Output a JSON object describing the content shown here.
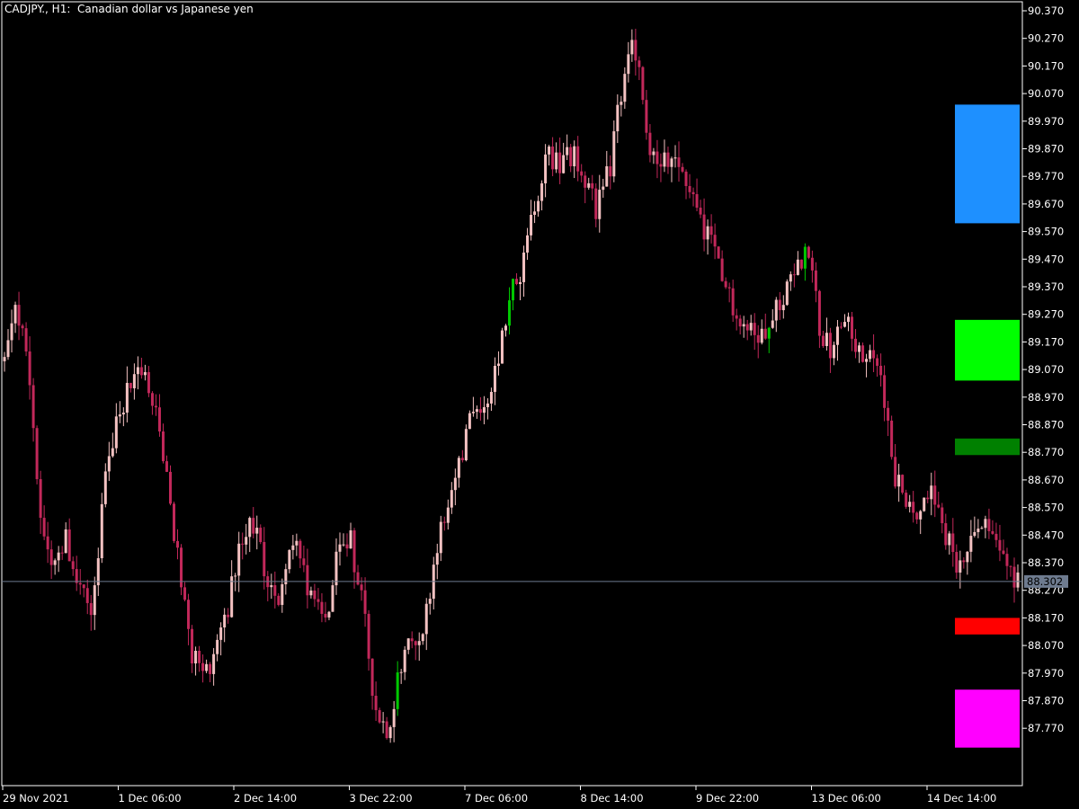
{
  "header": {
    "symbol": "CADJPY., H1:",
    "description": "Canadian dollar vs Japanese yen"
  },
  "colors": {
    "background": "#000000",
    "frame": "#ffffff",
    "bear": "#c2285a",
    "bull": "#f4c2c2",
    "bull_alt": "#00c800",
    "price_line": "#6e7b8f",
    "price_label_bg": "#6e7b8f",
    "tick_text": "#ffffff"
  },
  "chart_data": {
    "type": "candlestick",
    "ylim": [
      87.7,
      90.4
    ],
    "price_ticks": [
      "90.370",
      "90.270",
      "90.170",
      "90.070",
      "89.970",
      "89.870",
      "89.770",
      "89.670",
      "89.570",
      "89.470",
      "89.370",
      "89.270",
      "89.170",
      "89.070",
      "88.970",
      "88.870",
      "88.770",
      "88.670",
      "88.570",
      "88.470",
      "88.370",
      "88.270",
      "88.170",
      "88.070",
      "87.970",
      "87.870",
      "87.770"
    ],
    "time_ticks": [
      "29 Nov 2021",
      "1 Dec 06:00",
      "2 Dec 14:00",
      "3 Dec 22:00",
      "7 Dec 06:00",
      "8 Dec 14:00",
      "9 Dec 22:00",
      "13 Dec 06:00",
      "14 Dec 14:00"
    ],
    "current_price": 88.302,
    "current_price_label": "88.302",
    "bars_per_time_tick": 32,
    "close_path": [
      89.1,
      89.3,
      89.05,
      88.5,
      88.35,
      88.45,
      88.3,
      88.2,
      88.6,
      88.9,
      89.0,
      89.1,
      88.95,
      88.7,
      88.4,
      88.05,
      87.95,
      88.05,
      88.2,
      88.4,
      88.55,
      88.35,
      88.2,
      88.45,
      88.4,
      88.2,
      88.15,
      88.4,
      88.45,
      88.2,
      87.85,
      87.75,
      88.0,
      88.1,
      88.15,
      88.45,
      88.55,
      88.75,
      88.95,
      88.9,
      89.1,
      89.35,
      89.45,
      89.7,
      89.85,
      89.8,
      89.85,
      89.75,
      89.65,
      89.8,
      90.1,
      90.25,
      89.9,
      89.85,
      89.8,
      89.8,
      89.65,
      89.55,
      89.4,
      89.3,
      89.25,
      89.2,
      89.25,
      89.35,
      89.4,
      89.55,
      89.2,
      89.15,
      89.25,
      89.15,
      89.1,
      89.05,
      88.7,
      88.6,
      88.55,
      88.6,
      88.5,
      88.35,
      88.4,
      88.5,
      88.45,
      88.4,
      88.3
    ],
    "legend_boxes": [
      {
        "name": "box-blue",
        "color": "#1e90ff",
        "from": 89.6,
        "to": 90.03
      },
      {
        "name": "box-lime",
        "color": "#00ff00",
        "from": 89.03,
        "to": 89.25
      },
      {
        "name": "box-green",
        "color": "#008000",
        "from": 88.76,
        "to": 88.82
      },
      {
        "name": "box-red",
        "color": "#ff0000",
        "from": 88.11,
        "to": 88.17
      },
      {
        "name": "box-magenta",
        "color": "#ff00ff",
        "from": 87.7,
        "to": 87.91
      }
    ]
  }
}
